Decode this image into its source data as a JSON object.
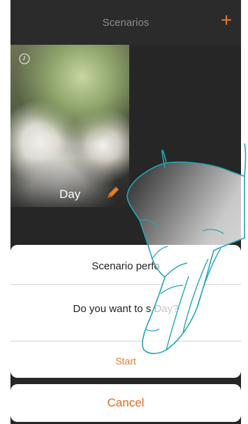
{
  "header": {
    "title": "Scenarios",
    "add_icon": "plus-icon",
    "accent_color": "#e87a2a"
  },
  "scenario_tile": {
    "label": "Day",
    "icons": [
      "clock-icon",
      "pencil-icon"
    ]
  },
  "dialog": {
    "title": "Scenario perfo",
    "message": "Do you want to s Day?",
    "start_label": "Start",
    "cancel_label": "Cancel"
  }
}
